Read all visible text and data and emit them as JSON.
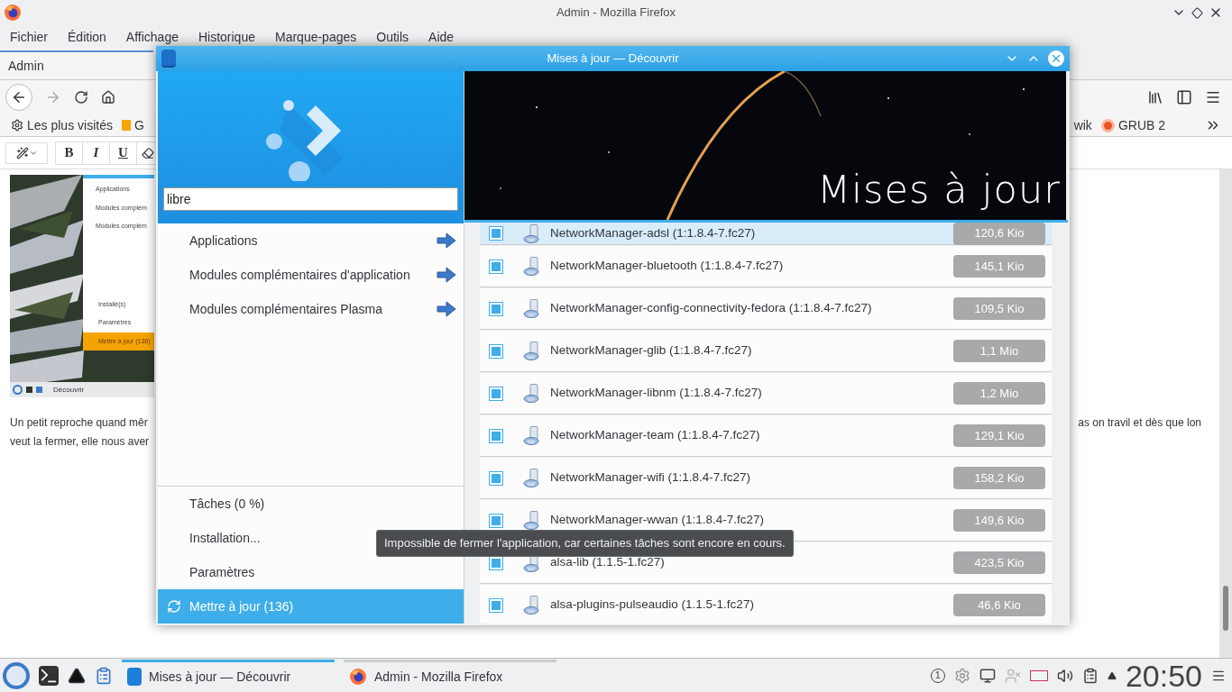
{
  "firefox": {
    "title": "Admin - Mozilla Firefox",
    "menu": [
      "Fichier",
      "Édition",
      "Affichage",
      "Historique",
      "Marque-pages",
      "Outils",
      "Aide"
    ],
    "tab": "Admin",
    "bookmarks_left": [
      "Les plus visités",
      "G"
    ],
    "bookmarks_right": [
      "wik",
      "GRUB 2"
    ],
    "format_buttons": [
      "B",
      "I",
      "U"
    ],
    "page": {
      "thumbnail": {
        "menu": [
          "Applications",
          "Modules complém",
          "Modules complém"
        ],
        "bottom": [
          "Installé(s)",
          "Paramètres"
        ],
        "update": "Mettre à jour (136)",
        "taskbar": "Découvrir"
      },
      "lines_left": [
        "Un petit reproche quand mêr",
        "veut la fermer, elle nous aver"
      ],
      "line_right": "as on travil et dès que lon"
    }
  },
  "discover": {
    "title": "Mises à jour — Découvrir",
    "search": {
      "value": "libre"
    },
    "categories": [
      "Applications",
      "Modules complémentaires d'application",
      "Modules complémentaires Plasma"
    ],
    "bottom_items": [
      {
        "label": "Tâches (0 %)",
        "selected": false
      },
      {
        "label": "Installation...",
        "selected": false
      },
      {
        "label": "Paramètres",
        "selected": false
      },
      {
        "label": "Mettre à jour (136)",
        "selected": true
      }
    ],
    "banner": "Mises à jour",
    "updates": [
      {
        "name": "NetworkManager-adsl (1:1.8.4-7.fc27)",
        "size": "120,6 Kio",
        "checked": true,
        "selected": true
      },
      {
        "name": "NetworkManager-bluetooth (1:1.8.4-7.fc27)",
        "size": "145,1 Kio",
        "checked": true,
        "selected": false
      },
      {
        "name": "NetworkManager-config-connectivity-fedora (1:1.8.4-7.fc27)",
        "size": "109,5 Kio",
        "checked": true,
        "selected": false
      },
      {
        "name": "NetworkManager-glib (1:1.8.4-7.fc27)",
        "size": "1,1 Mio",
        "checked": true,
        "selected": false
      },
      {
        "name": "NetworkManager-libnm (1:1.8.4-7.fc27)",
        "size": "1,2 Mio",
        "checked": true,
        "selected": false
      },
      {
        "name": "NetworkManager-team (1:1.8.4-7.fc27)",
        "size": "129,1 Kio",
        "checked": true,
        "selected": false
      },
      {
        "name": "NetworkManager-wifi (1:1.8.4-7.fc27)",
        "size": "158,2 Kio",
        "checked": true,
        "selected": false
      },
      {
        "name": "NetworkManager-wwan (1:1.8.4-7.fc27)",
        "size": "149,6 Kio",
        "checked": true,
        "selected": false
      },
      {
        "name": "alsa-lib (1.1.5-1.fc27)",
        "size": "423,5 Kio",
        "checked": true,
        "selected": false
      },
      {
        "name": "alsa-plugins-pulseaudio (1.1.5-1.fc27)",
        "size": "46,6 Kio",
        "checked": true,
        "selected": false
      }
    ],
    "tooltip": "Impossible de fermer l'application, car certaines tâches sont encore en cours."
  },
  "taskbar": {
    "tasks": [
      {
        "label": "Mises à jour — Découvrir",
        "selected": true
      },
      {
        "label": "Admin - Mozilla Firefox",
        "selected": false
      }
    ],
    "tray_badge": "1",
    "clock": "20:50"
  }
}
